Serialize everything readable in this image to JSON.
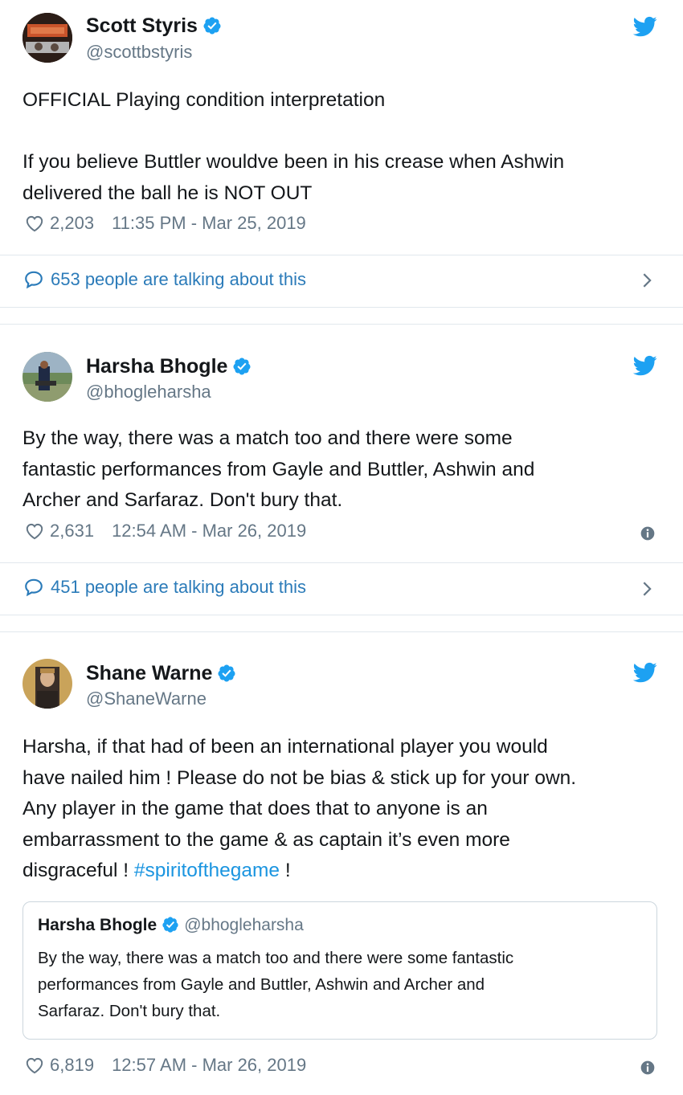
{
  "tweets": [
    {
      "author": {
        "name": "Scott Styris",
        "handle": "@scottbstyris"
      },
      "text_lines": [
        "OFFICIAL Playing condition interpretation",
        "",
        "If you believe Buttler wouldve been in his crease when Ashwin",
        "delivered the ball he is NOT OUT"
      ],
      "likes": "2,203",
      "timestamp": "11:35 PM - Mar 25, 2019",
      "talking": "653 people are talking about this"
    },
    {
      "author": {
        "name": "Harsha Bhogle",
        "handle": "@bhogleharsha"
      },
      "text_lines": [
        "By the way, there was a match too and there were some",
        "fantastic performances from Gayle and Buttler, Ashwin and",
        "Archer and Sarfaraz. Don't bury that."
      ],
      "likes": "2,631",
      "timestamp": "12:54 AM - Mar 26, 2019",
      "talking": "451 people are talking about this"
    },
    {
      "author": {
        "name": "Shane Warne",
        "handle": "@ShaneWarne"
      },
      "text_lines": [
        "Harsha, if that had of been an international player you would",
        "have nailed him ! Please do not be bias & stick up for your own.",
        "Any player in the game that does that to anyone is an",
        "embarrassment to the game & as captain it’s even more"
      ],
      "last_line_prefix": "disgraceful ! ",
      "hashtag": "#spiritofthegame",
      "last_line_suffix": " !",
      "quote": {
        "name": "Harsha Bhogle",
        "handle": "@bhogleharsha",
        "text_lines": [
          "By the way, there was a match too and there were some fantastic",
          "performances from Gayle and Buttler, Ashwin and Archer and",
          "Sarfaraz. Don't bury that."
        ]
      },
      "likes": "6,819",
      "timestamp": "12:57 AM - Mar 26, 2019"
    }
  ],
  "icons": {
    "brand": "twitter-bird-icon",
    "verified": "verified-badge-icon",
    "like": "heart-icon",
    "reply": "speech-bubble-icon",
    "info": "info-icon",
    "chevron": "chevron-right-icon"
  },
  "colors": {
    "twitter_blue": "#1da1f2",
    "link_blue": "#2b7bb9",
    "muted": "#657786",
    "divider": "#e1e8ed"
  }
}
